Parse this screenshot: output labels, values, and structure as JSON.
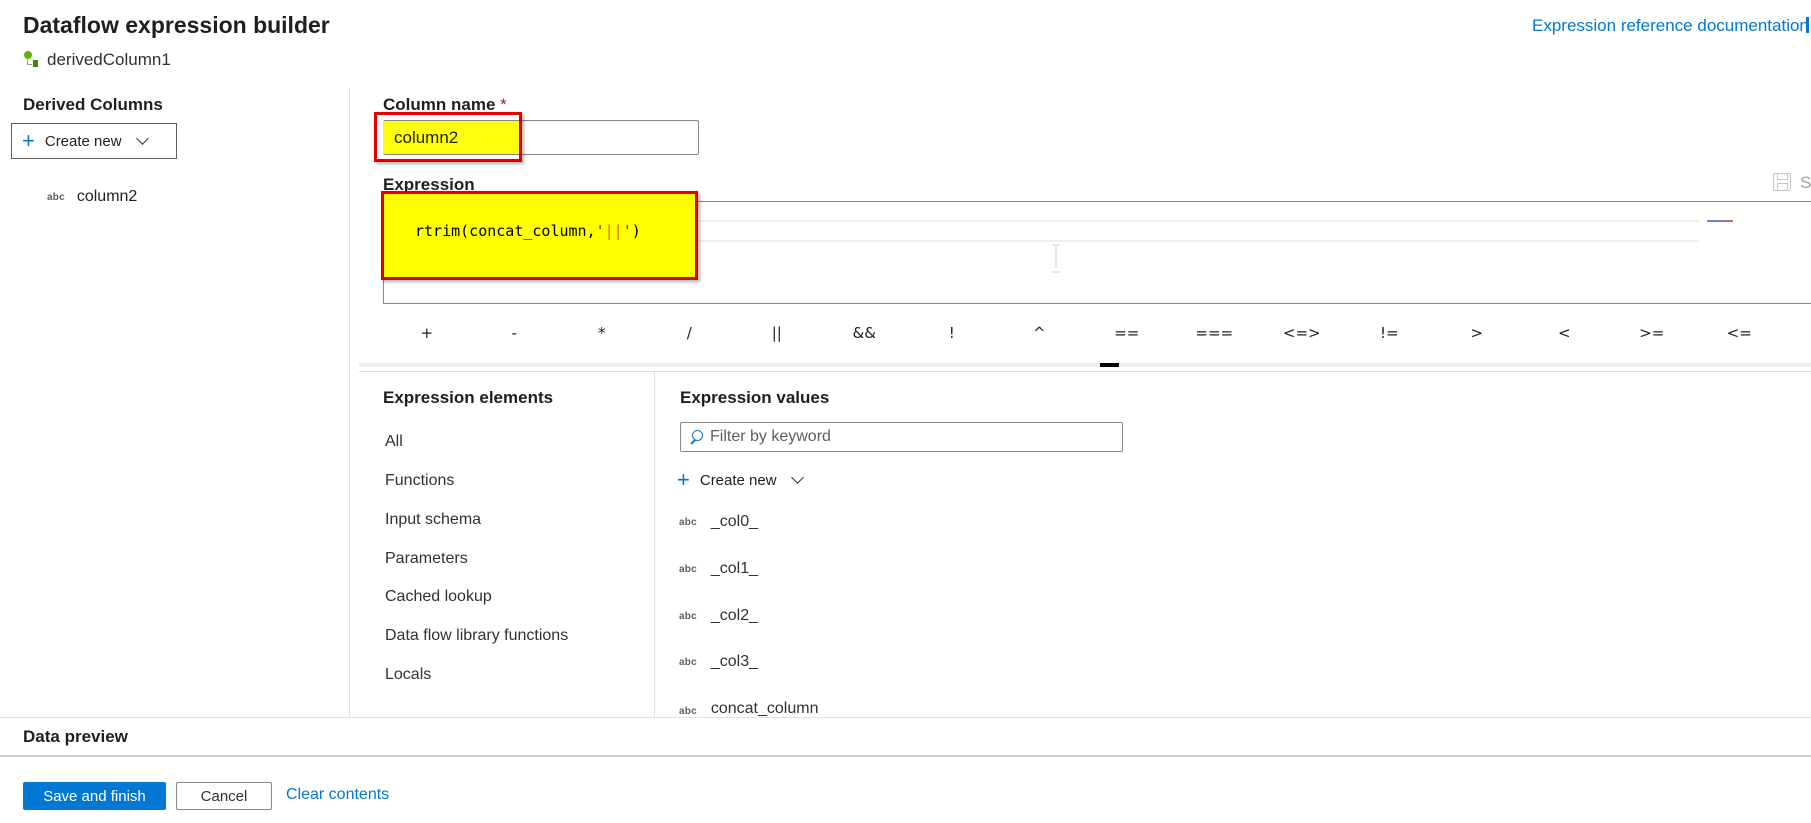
{
  "header": {
    "title": "Dataflow expression builder",
    "subtitle": "derivedColumn1",
    "doc_link": "Expression reference documentation"
  },
  "derived_columns": {
    "heading": "Derived Columns",
    "create_new_label": "Create new",
    "items": [
      {
        "type_badge": "abc",
        "name": "column2"
      }
    ]
  },
  "column_name": {
    "label": "Column name",
    "required_marker": "*",
    "value": "column2"
  },
  "expression": {
    "label": "Expression",
    "code_prefix": "rtrim(concat_column,",
    "code_string_open": "'",
    "code_string_body": "||",
    "code_string_close": "'",
    "code_suffix": ")",
    "save_label": "S"
  },
  "operators": [
    "+",
    "-",
    "*",
    "/",
    "||",
    "&&",
    "!",
    "^",
    "==",
    "===",
    "<=>",
    "!=",
    ">",
    "<",
    ">=",
    "<=",
    "["
  ],
  "expression_elements": {
    "heading": "Expression elements",
    "items": [
      "All",
      "Functions",
      "Input schema",
      "Parameters",
      "Cached lookup",
      "Data flow library functions",
      "Locals"
    ]
  },
  "expression_values": {
    "heading": "Expression values",
    "filter_placeholder": "Filter by keyword",
    "create_new_label": "Create new",
    "items": [
      {
        "type_badge": "abc",
        "name": "_col0_"
      },
      {
        "type_badge": "abc",
        "name": "_col1_"
      },
      {
        "type_badge": "abc",
        "name": "_col2_"
      },
      {
        "type_badge": "abc",
        "name": "_col3_"
      },
      {
        "type_badge": "abc",
        "name": "concat_column"
      }
    ]
  },
  "footer": {
    "data_preview_label": "Data preview",
    "save_button": "Save and finish",
    "cancel_button": "Cancel",
    "clear_link": "Clear contents"
  },
  "colors": {
    "accent": "#0078d4",
    "highlight": "#ffff00",
    "annotation_border": "#e00000"
  }
}
